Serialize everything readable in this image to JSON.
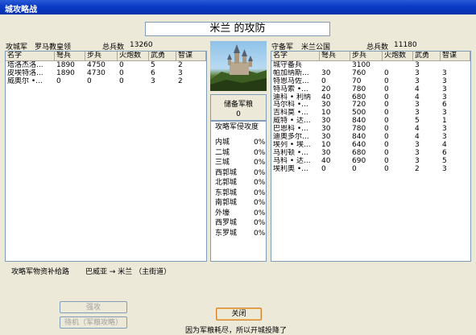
{
  "window": {
    "title": "城攻略战"
  },
  "heading": "米兰 的攻防",
  "attacker": {
    "side_label": "攻城军",
    "commander": "罗马教皇领",
    "total_label": "总兵数",
    "total": "13260",
    "columns": [
      "名字",
      "弩兵",
      "步兵",
      "火炮数",
      "武勇",
      "智谋"
    ],
    "rows": [
      [
        "塔洛杰洛...",
        "1890",
        "4750",
        "0",
        "5",
        "2"
      ],
      [
        "皮埃特洛...",
        "1890",
        "4730",
        "0",
        "6",
        "3"
      ],
      [
        "威奥尔 •...",
        "0",
        "0",
        "0",
        "3",
        "2"
      ]
    ]
  },
  "defender": {
    "side_label": "守备军",
    "commander": "米兰公国",
    "total_label": "总兵数",
    "total": "11180",
    "columns": [
      "名字",
      "弩兵",
      "步兵",
      "火炮数",
      "武勇",
      "智谋"
    ],
    "rows": [
      [
        "城守备兵",
        "",
        "3100",
        "",
        "3",
        ""
      ],
      [
        "帕加纳斯...",
        "30",
        "760",
        "0",
        "3",
        "3"
      ],
      [
        "特恩马佐...",
        "0",
        "70",
        "0",
        "3",
        "3"
      ],
      [
        "特马索 •...",
        "20",
        "780",
        "0",
        "4",
        "3"
      ],
      [
        "迪科 • 利纳",
        "40",
        "680",
        "0",
        "4",
        "3"
      ],
      [
        "马尔科 •...",
        "30",
        "720",
        "0",
        "3",
        "6"
      ],
      [
        "吉科莫 •...",
        "10",
        "500",
        "0",
        "3",
        "3"
      ],
      [
        "威特 • 达...",
        "30",
        "840",
        "0",
        "5",
        "1"
      ],
      [
        "巴恩科 •...",
        "30",
        "780",
        "0",
        "4",
        "3"
      ],
      [
        "迪奥多尔...",
        "30",
        "840",
        "0",
        "4",
        "3"
      ],
      [
        "埃列 • 埃...",
        "10",
        "640",
        "0",
        "3",
        "4"
      ],
      [
        "马利顿 •...",
        "30",
        "680",
        "0",
        "3",
        "6"
      ],
      [
        "马科 • 达...",
        "40",
        "690",
        "0",
        "3",
        "5"
      ],
      [
        "埃利奥 •...",
        "0",
        "0",
        "0",
        "2",
        "3"
      ]
    ]
  },
  "reserve": {
    "label": "储备军粮",
    "value": "0"
  },
  "invasion": {
    "header": "攻略军侵攻度",
    "rows": [
      [
        "内城",
        "0%"
      ],
      [
        "二城",
        "0%"
      ],
      [
        "三城",
        "0%"
      ],
      [
        "西郭城",
        "0%"
      ],
      [
        "北郭城",
        "0%"
      ],
      [
        "东郭城",
        "0%"
      ],
      [
        "南郭城",
        "0%"
      ],
      [
        "外壕",
        "0%"
      ],
      [
        "西罗城",
        "0%"
      ],
      [
        "东罗城",
        "0%"
      ]
    ]
  },
  "supply": {
    "label": "攻略军物资补给路",
    "route": "巴威亚 → 米兰 （主街道）"
  },
  "buttons": {
    "assault": "强攻",
    "wait": "待机（军粮攻略）",
    "close": "关闭"
  },
  "status_message": "因为军粮耗尽，所以开城投降了"
}
